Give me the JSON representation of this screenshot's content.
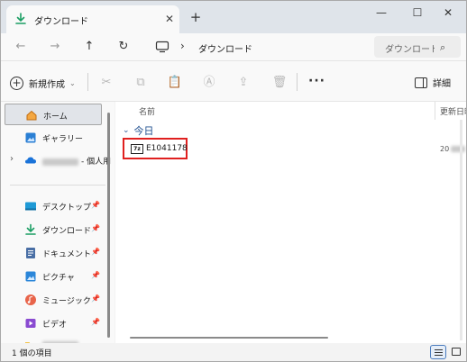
{
  "window": {
    "tab_title": "ダウンロード",
    "tab_close": "✕",
    "new_tab": "+",
    "minimize": "—",
    "maximize": "☐",
    "close": "✕"
  },
  "address": {
    "back": "←",
    "forward": "→",
    "up": "↑",
    "refresh": "↻",
    "separator": "›",
    "path": "ダウンロード",
    "search_placeholder": "ダウンロードの検索"
  },
  "toolbar": {
    "new_label": "新規作成",
    "new_caret": "⌄",
    "more": "···",
    "details_label": "詳細"
  },
  "nav": {
    "items": [
      {
        "label": "ホーム",
        "icon": "home-icon",
        "selected": true
      },
      {
        "label": "ギャラリー",
        "icon": "gallery-icon"
      },
      {
        "label": "- 個人用",
        "icon": "onedrive-icon",
        "expandable": true
      },
      {
        "label": "デスクトップ",
        "icon": "desktop-icon",
        "pinned": true
      },
      {
        "label": "ダウンロード",
        "icon": "download-icon",
        "pinned": true
      },
      {
        "label": "ドキュメント",
        "icon": "documents-icon",
        "pinned": true
      },
      {
        "label": "ピクチャ",
        "icon": "pictures-icon",
        "pinned": true
      },
      {
        "label": "ミュージック",
        "icon": "music-icon",
        "pinned": true
      },
      {
        "label": "ビデオ",
        "icon": "videos-icon",
        "pinned": true
      }
    ],
    "pin_glyph": "📌"
  },
  "content": {
    "columns": {
      "name": "名前",
      "date": "更新日時"
    },
    "group": "今日",
    "files": [
      {
        "name": "E1041178",
        "icon": "7z-archive-icon",
        "icon_text": "7z",
        "date_prefix": "20"
      }
    ]
  },
  "status": {
    "item_count": "1 個の項目"
  },
  "colors": {
    "accent": "#1f4f8f",
    "highlight_border": "#e0201f",
    "download_green": "#1a9e63"
  }
}
